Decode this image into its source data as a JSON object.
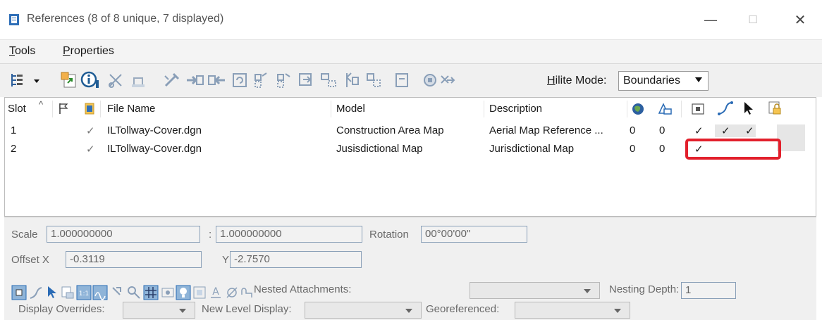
{
  "window": {
    "title": "References (8 of 8 unique, 7 displayed)",
    "minimize": "—",
    "maximize": "☐",
    "close": "✕"
  },
  "menu": {
    "tools": "Tools",
    "tools_hotkey": "T",
    "tools_rest": "ools",
    "properties": "Properties",
    "properties_hotkey": "P",
    "properties_rest": "roperties"
  },
  "toolbar": {
    "hilite_label_hotkey": "H",
    "hilite_label_rest": "ilite Mode:",
    "hilite_value": "Boundaries"
  },
  "grid": {
    "headers": {
      "slot": "Slot",
      "file_name": "File Name",
      "model": "Model",
      "description": "Description"
    },
    "rows": [
      {
        "slot": "1",
        "check": "✓",
        "file": "ILTollway-Cover.dgn",
        "model": "Construction Area Map",
        "description": "Aerial Map Reference ...",
        "c1": "0",
        "c2": "0",
        "display": "✓",
        "snap": "✓",
        "locate": "✓"
      },
      {
        "slot": "2",
        "check": "✓",
        "file": "ILTollway-Cover.dgn",
        "model": "Jusisdictional Map",
        "description": "Jurisdictional Map",
        "c1": "0",
        "c2": "0",
        "display": "✓",
        "snap": "",
        "locate": ""
      }
    ]
  },
  "props": {
    "scale_label": "Scale",
    "scale_value": "1.000000000",
    "scale_sep": ":",
    "scale_value2": "1.000000000",
    "rotation_label": "Rotation",
    "rotation_value": "00°00'00\"",
    "offset_x_label": "Offset X",
    "offset_x_value": "-0.3119",
    "y_label": "Y",
    "y_value": "-2.7570",
    "nested_label": "Nested Attachments:",
    "nesting_label": "Nesting Depth:",
    "nesting_value": "1",
    "display_overrides_label": "Display Overrides:",
    "new_level_label": "New Level Display:",
    "georef_label": "Georeferenced:"
  },
  "colors": {
    "highlight": "#e2202c",
    "accent": "#4a7fb5"
  }
}
